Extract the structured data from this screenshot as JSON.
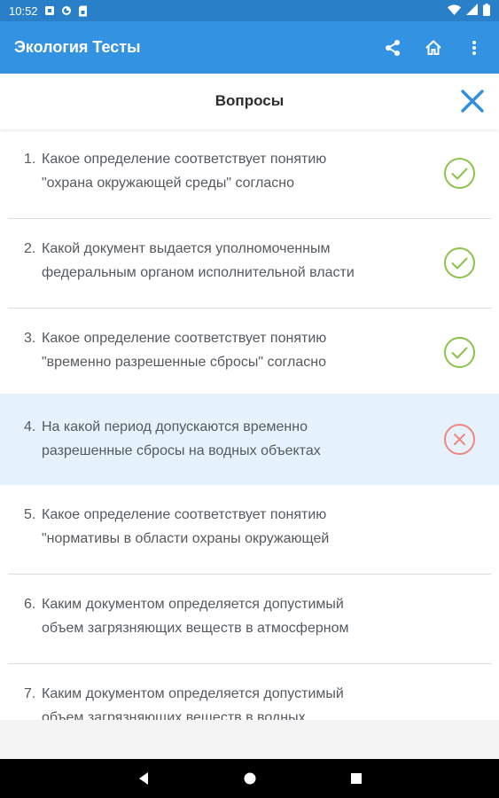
{
  "status_bar": {
    "time": "10:52",
    "left_icons": [
      "notification-square-icon",
      "vpn-icon",
      "sim-card-icon"
    ],
    "right_icons": [
      "wifi-icon",
      "signal-icon",
      "battery-icon"
    ]
  },
  "app_bar": {
    "title": "Экология Тесты",
    "actions": [
      "share-icon",
      "home-icon",
      "more-vert-icon"
    ]
  },
  "sheet": {
    "title": "Вопросы",
    "close_icon": "close-icon"
  },
  "questions": [
    {
      "number": "1.",
      "line1": "Какое определение соответствует понятию",
      "line2": "\"охрана окружающей среды\" согласно",
      "status": "correct"
    },
    {
      "number": "2.",
      "line1": "Какой документ выдается уполномоченным",
      "line2": "федеральным органом исполнительной власти",
      "status": "correct"
    },
    {
      "number": "3.",
      "line1": "Какое определение соответствует понятию",
      "line2": "\"временно разрешенные сбросы\" согласно",
      "status": "correct"
    },
    {
      "number": "4.",
      "line1": "На какой период допускаются временно",
      "line2": "разрешенные сбросы на водных объектах",
      "status": "wrong"
    },
    {
      "number": "5.",
      "line1": "Какое определение соответствует понятию",
      "line2": "\"нормативы в области охраны окружающей",
      "status": "none"
    },
    {
      "number": "6.",
      "line1": "Каким документом определяется допустимый",
      "line2": "объем загрязняющих веществ в атмосферном",
      "status": "none"
    },
    {
      "number": "7.",
      "line1": "Каким документом определяется допустимый",
      "line2": "объем загрязняющих веществ в водных",
      "status": "none"
    }
  ],
  "colors": {
    "status_bar": "#2a7fc9",
    "app_bar": "#3392e1",
    "correct": "#8bc34a",
    "wrong": "#f0877e",
    "highlight": "#e5f1fb",
    "close": "#2e8fe0"
  },
  "nav_bar": {
    "buttons": [
      "back-icon",
      "home-circle-icon",
      "recents-icon"
    ]
  }
}
